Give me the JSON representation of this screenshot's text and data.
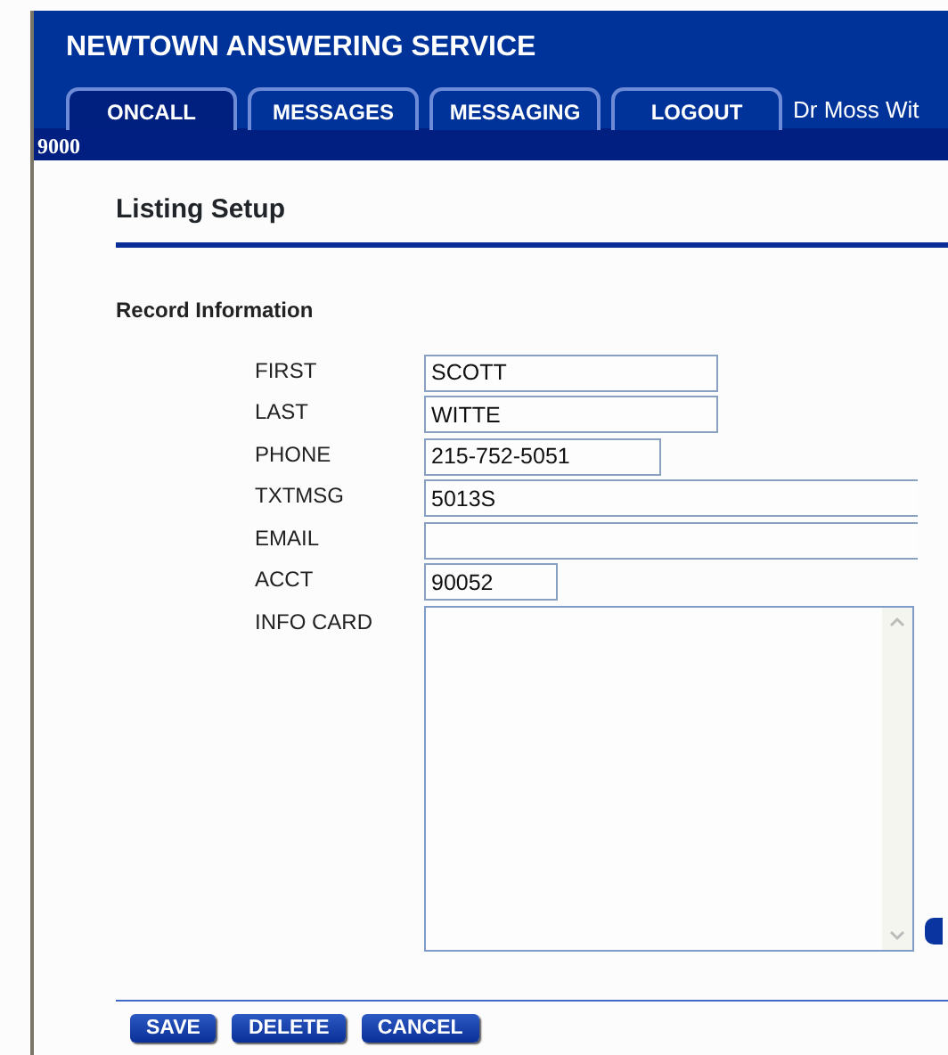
{
  "header": {
    "title": "NEWTOWN ANSWERING SERVICE",
    "tabs": [
      {
        "label": "ONCALL",
        "selected": true
      },
      {
        "label": "MESSAGES",
        "selected": false
      },
      {
        "label": "MESSAGING",
        "selected": false
      },
      {
        "label": "LOGOUT",
        "selected": false
      }
    ],
    "user": "Dr Moss Wit",
    "account_code": "9000"
  },
  "page_title": "Listing Setup",
  "section_title": "Record Information",
  "fields": [
    {
      "label": "FIRST",
      "value": "SCOTT"
    },
    {
      "label": "LAST",
      "value": "WITTE"
    },
    {
      "label": "PHONE",
      "value": "215-752-5051"
    },
    {
      "label": "TXTMSG",
      "value": "5013S"
    },
    {
      "label": "EMAIL"
    },
    {
      "label": "ACCT",
      "value": "90052"
    }
  ],
  "info_card": {
    "label": "INFO CARD"
  },
  "buttons": [
    "SAVE",
    "DELETE",
    "CANCEL"
  ]
}
